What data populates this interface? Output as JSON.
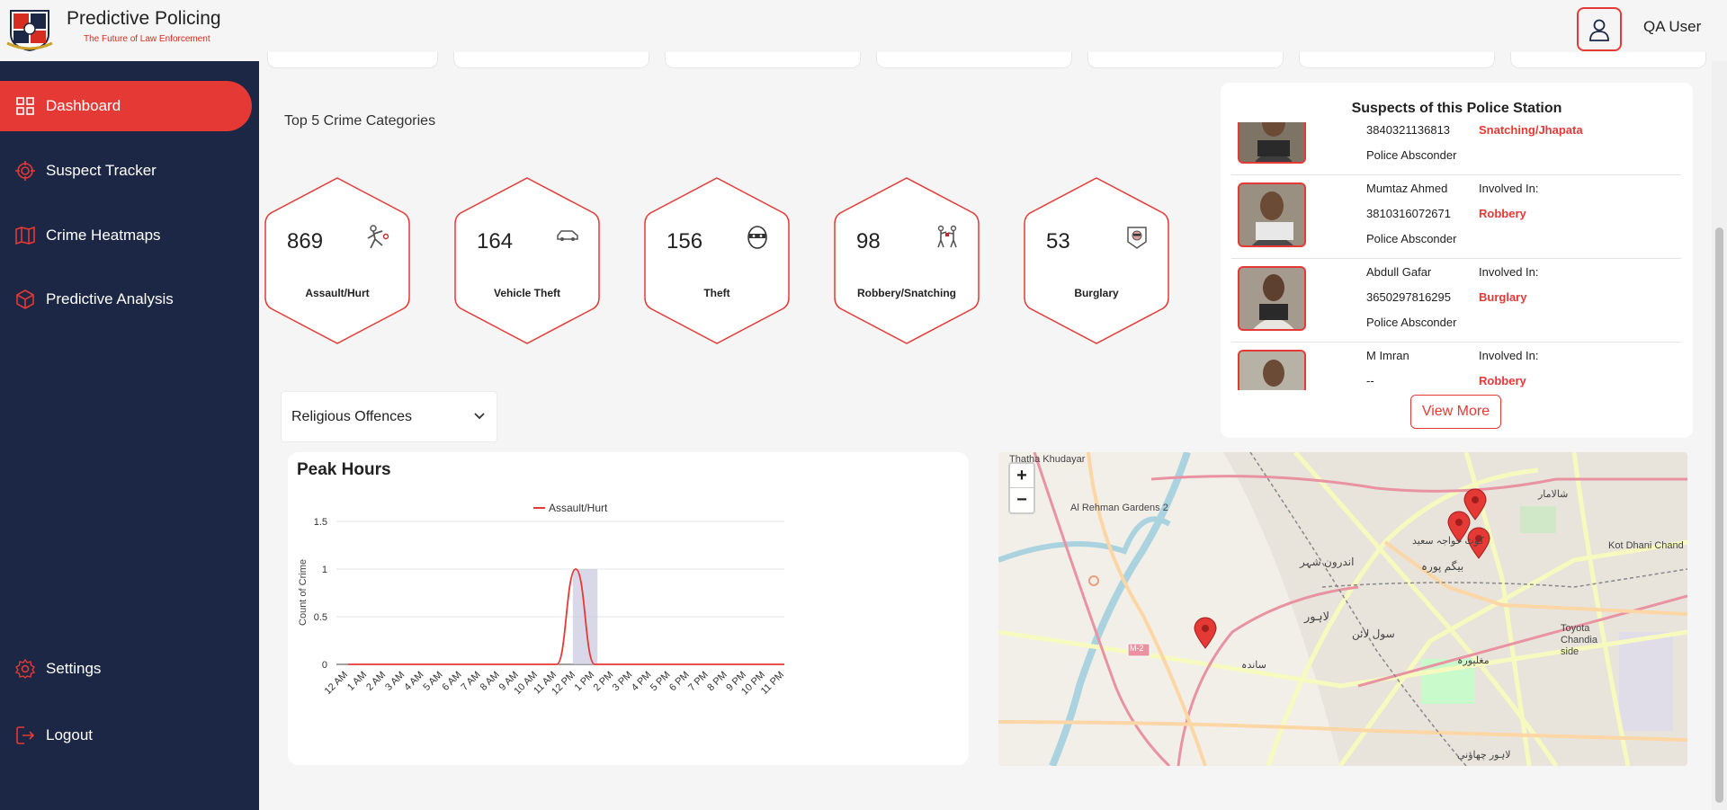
{
  "header": {
    "app_title": "Predictive Policing",
    "app_subtitle": "The Future of Law Enforcement",
    "user_name": "QA User"
  },
  "sidebar": {
    "items": [
      {
        "label": "Dashboard",
        "icon": "grid-icon",
        "active": true
      },
      {
        "label": "Suspect Tracker",
        "icon": "target-icon"
      },
      {
        "label": "Crime Heatmaps",
        "icon": "map-icon"
      },
      {
        "label": "Predictive Analysis",
        "icon": "cube-icon"
      }
    ],
    "settings_label": "Settings",
    "logout_label": "Logout"
  },
  "top_categories": {
    "title": "Top 5 Crime Categories",
    "items": [
      {
        "count": "869",
        "label": "Assault/Hurt"
      },
      {
        "count": "164",
        "label": "Vehicle Theft"
      },
      {
        "count": "156",
        "label": "Theft"
      },
      {
        "count": "98",
        "label": "Robbery/Snatching"
      },
      {
        "count": "53",
        "label": "Burglary"
      }
    ]
  },
  "filter": {
    "selected": "Religious Offences"
  },
  "chart_data": {
    "type": "line",
    "title": "Peak Hours",
    "ylabel": "Count of Crime",
    "xlabel": "",
    "ylim": [
      0,
      1.5
    ],
    "yticks": [
      "0",
      "0.5",
      "1",
      "1.5"
    ],
    "categories": [
      "12 AM",
      "1 AM",
      "2 AM",
      "3 AM",
      "4 AM",
      "5 AM",
      "6 AM",
      "7 AM",
      "8 AM",
      "9 AM",
      "10 AM",
      "11 AM",
      "12 PM",
      "1 PM",
      "2 PM",
      "3 PM",
      "4 PM",
      "5 PM",
      "6 PM",
      "7 PM",
      "8 PM",
      "9 PM",
      "10 PM",
      "11 PM"
    ],
    "series": [
      {
        "name": "Assault/Hurt",
        "color": "#e53935",
        "values": [
          0,
          0,
          0,
          0,
          0,
          0,
          0,
          0,
          0,
          0,
          0,
          0,
          1,
          0,
          0,
          0,
          0,
          0,
          0,
          0,
          0,
          0,
          0,
          0
        ]
      }
    ],
    "legend": "top-center",
    "grid": true,
    "highlight_category": "12 PM"
  },
  "suspects": {
    "title": "Suspects of this Police Station",
    "involved_label": "Involved In:",
    "rows": [
      {
        "name": "",
        "cnic": "3840321136813",
        "status": "Police Absconder",
        "crime": "Snatching/Jhapata"
      },
      {
        "name": "Mumtaz Ahmed",
        "cnic": "3810316072671",
        "status": "Police Absconder",
        "crime": "Robbery"
      },
      {
        "name": "Abdull Gafar",
        "cnic": "3650297816295",
        "status": "Police Absconder",
        "crime": "Burglary"
      },
      {
        "name": "M Imran",
        "cnic": "--",
        "status": "",
        "crime": "Robbery"
      }
    ],
    "view_more_label": "View More"
  },
  "map": {
    "zoom_in": "+",
    "zoom_out": "−",
    "labels": [
      "Thatha Khudayar",
      "Al Rehman Gardens 2",
      "Kot Dhani Chand",
      "Toyota Chandia side",
      "M-2",
      "لاہور",
      "اندرون شہر",
      "بیگم پورہ",
      "سول لائن",
      "شالامار",
      "ساندہ",
      "لاہور چھاؤنی",
      "مغلپورہ",
      "کوٹ خواجہ سعید"
    ]
  },
  "colors": {
    "accent": "#e53935",
    "sidebar_bg": "#1b2744",
    "page_bg": "#f5f5f5"
  }
}
